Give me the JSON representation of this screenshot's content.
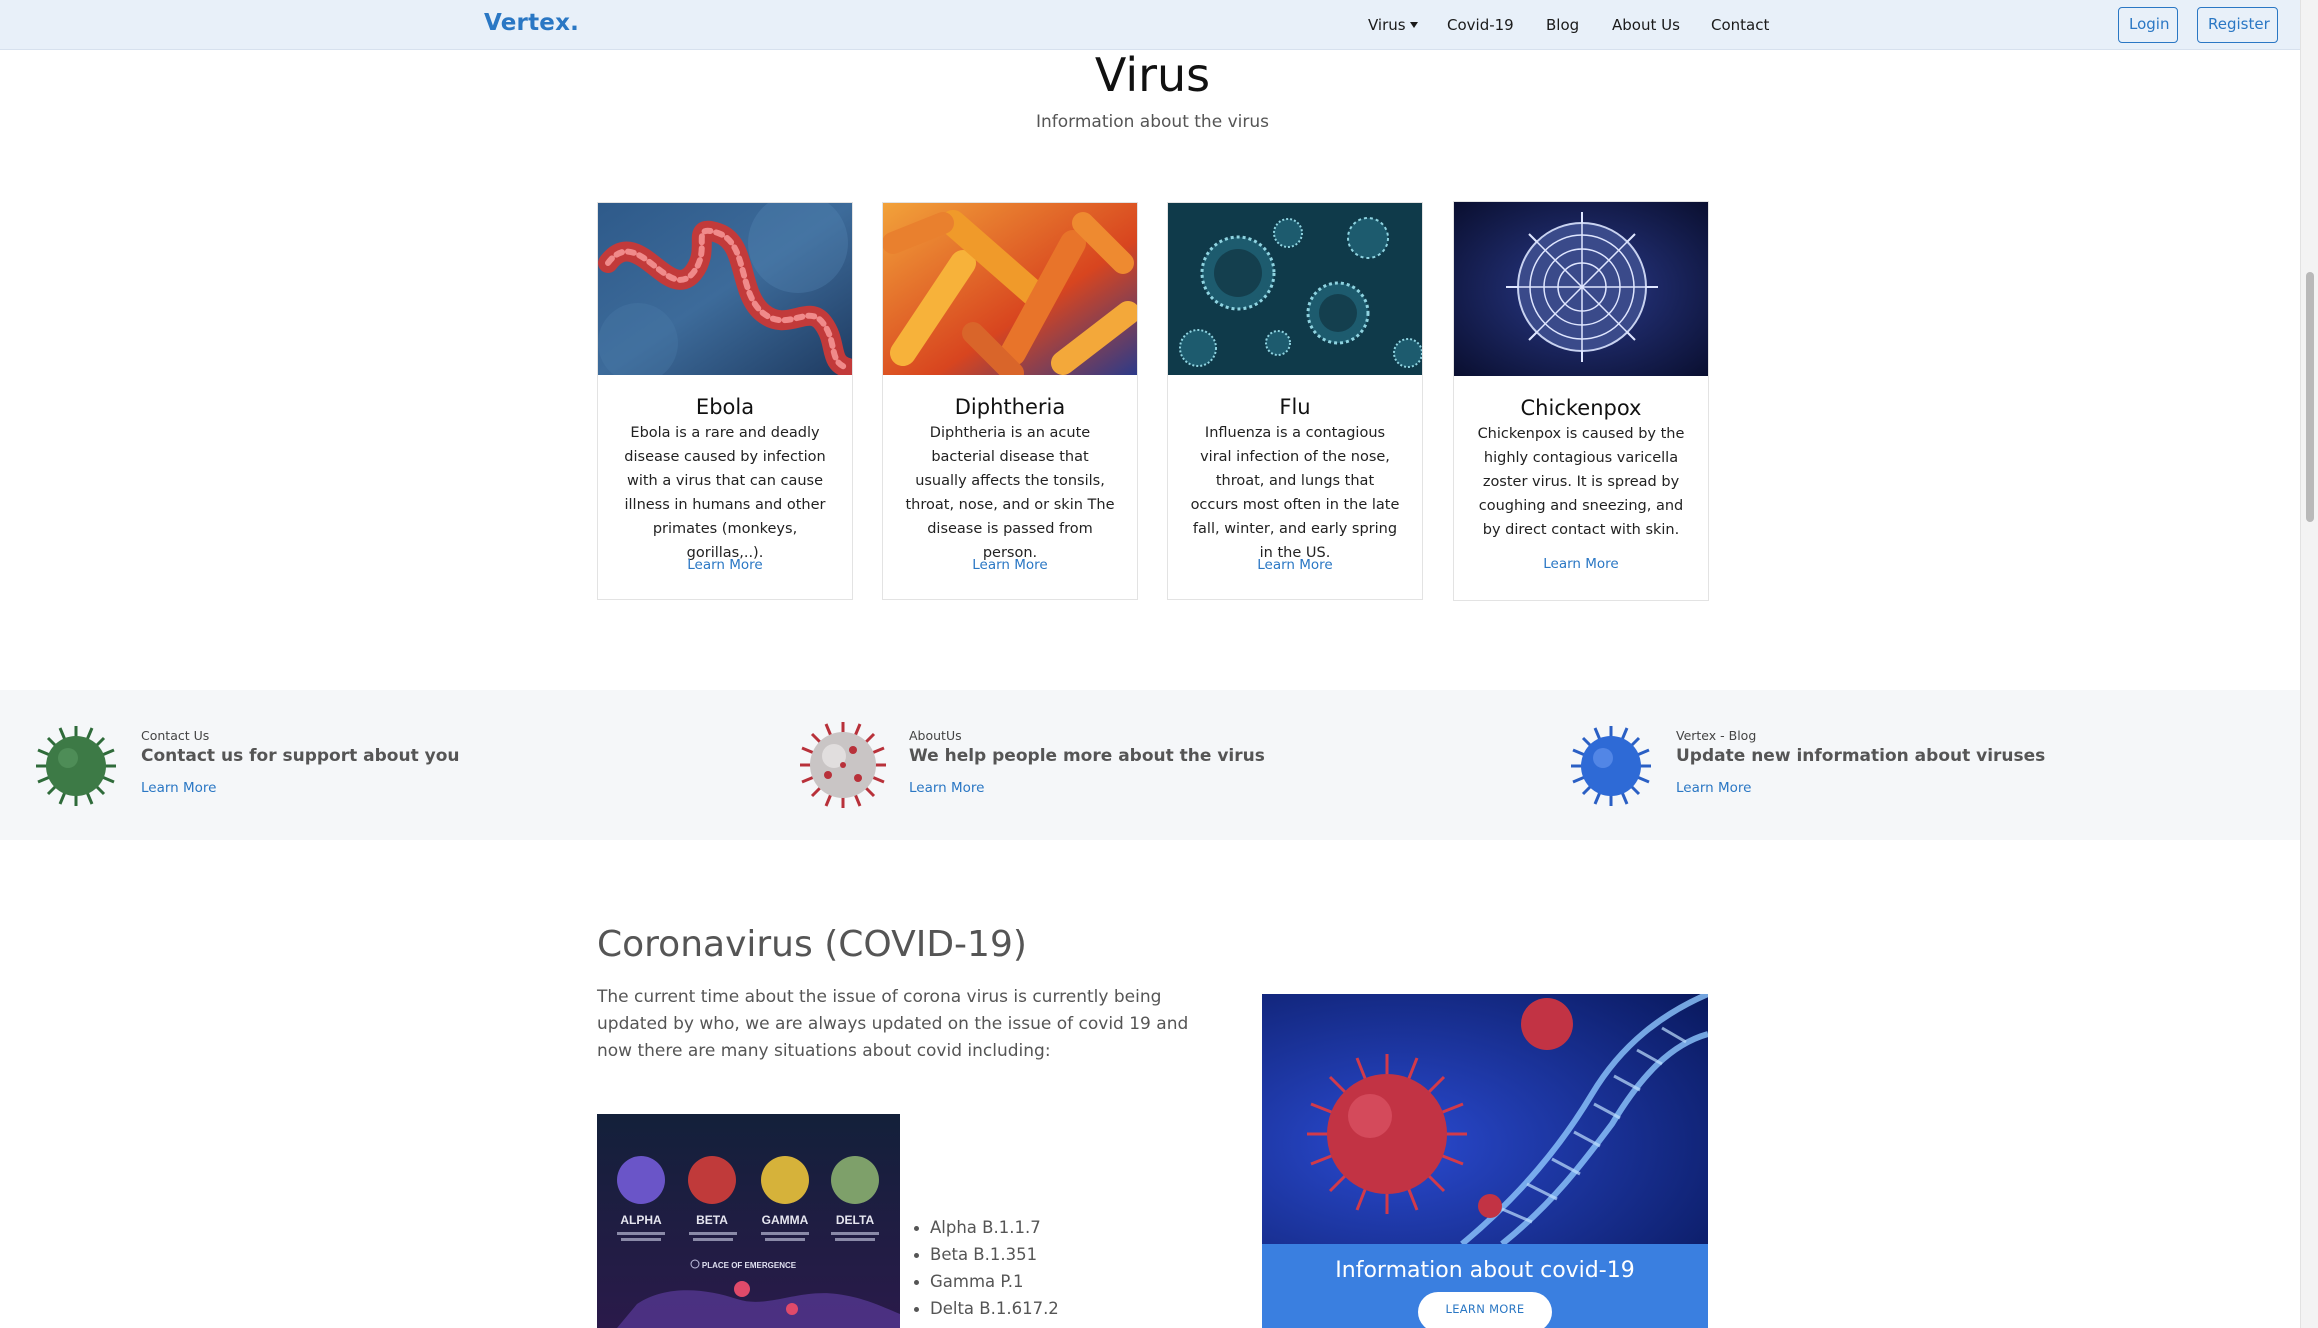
{
  "nav": {
    "logo": "Vertex.",
    "links": [
      "Virus",
      "Covid-19",
      "Blog",
      "About Us",
      "Contact"
    ],
    "login": "Login",
    "register": "Register"
  },
  "virus_section": {
    "title": "Virus",
    "subtitle": "Information about the virus",
    "cards": [
      {
        "title": "Ebola",
        "text": "Ebola is a rare and deadly disease caused by infection with a virus that can cause illness in humans and other primates (monkeys, gorillas,..).",
        "link": "Learn More"
      },
      {
        "title": "Diphtheria",
        "text": "Diphtheria is an acute bacterial disease that usually affects the tonsils, throat, nose, and or skin The disease is passed from person.",
        "link": "Learn More"
      },
      {
        "title": "Flu",
        "text": "Influenza is a contagious viral infection of the nose, throat, and lungs that occurs most often in the late fall, winter, and early spring in the US.",
        "link": "Learn More"
      },
      {
        "title": "Chickenpox",
        "text": "Chickenpox is caused by the highly contagious varicella zoster virus. It is spread by coughing and sneezing, and by direct contact with skin.",
        "link": "Learn More"
      }
    ]
  },
  "band": {
    "items": [
      {
        "small": "Contact Us",
        "title": "Contact us for support about you",
        "link": "Learn More",
        "color": "#2f6b3a"
      },
      {
        "small": "AboutUs",
        "title": "We help people more about the virus",
        "link": "Learn More",
        "color": "#b8313a"
      },
      {
        "small": "Vertex - Blog",
        "title": "Update new information about viruses",
        "link": "Learn More",
        "color": "#2a5fc4"
      }
    ]
  },
  "covid": {
    "title": "Coronavirus (COVID-19)",
    "text": "The current time about the issue of corona virus is currently being updated by who, we are always updated on the issue of covid 19 and now there are many situations about covid including:",
    "variants_image": {
      "labels": [
        "ALPHA",
        "BETA",
        "GAMMA",
        "DELTA"
      ],
      "caption": "PLACE OF EMERGENCE"
    },
    "variants": [
      "Alpha B.1.1.7",
      "Beta B.1.351",
      "Gamma P.1",
      "Delta B.1.617.2"
    ],
    "card_title": "Information about covid-19",
    "card_button": "LEARN MORE"
  },
  "colors": {
    "accent": "#2a77c4",
    "nav_bg": "#e8f0f9",
    "covid_card": "#3a7fe0"
  }
}
